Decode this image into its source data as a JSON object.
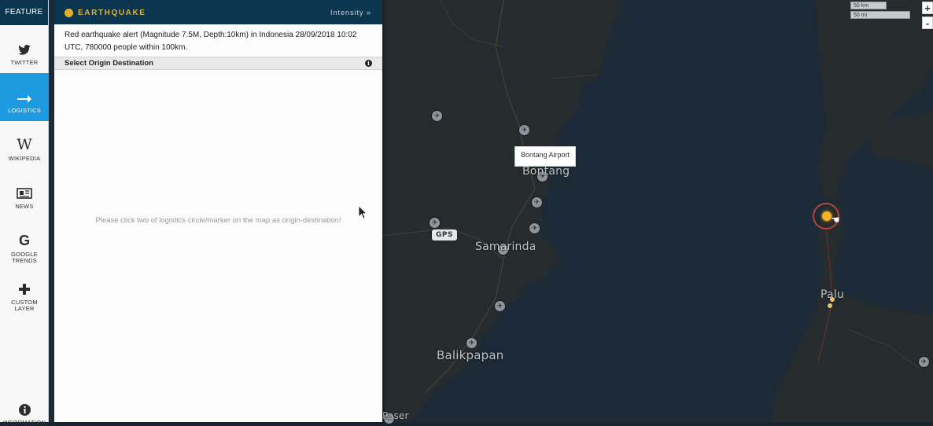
{
  "sidebar": {
    "header": "FEATURE",
    "items": [
      {
        "label": "TWITTER",
        "icon": "twitter-icon",
        "active": false
      },
      {
        "label": "LOGISTICS",
        "icon": "arrow-right-icon",
        "active": true
      },
      {
        "label": "WIKIPEDIA",
        "icon": "wikipedia-icon",
        "active": false
      },
      {
        "label": "NEWS",
        "icon": "newspaper-icon",
        "active": false
      },
      {
        "label_line1": "GOOGLE",
        "label_line2": "TRENDS",
        "icon": "google-icon",
        "active": false
      },
      {
        "label_line1": "CUSTOM",
        "label_line2": "LAYER",
        "icon": "plus-icon",
        "active": false
      },
      {
        "label": "INFORMATION",
        "icon": "info-icon",
        "active": false
      }
    ]
  },
  "panel": {
    "title": "EARTHQUAKE",
    "intensity_label": "Intensity »",
    "description": "Red earthquake alert (Magnitude 7.5M, Depth:10km) in Indonesia 28/09/2018 10:02 UTC, 780000 people within 100km.",
    "section_title": "Select Origin Destination",
    "hint": "Please click two of logistics circle/marker on the map as origin-destination!"
  },
  "map": {
    "tooltip": "Bontang Airport",
    "badge": "GPS",
    "labels": {
      "bontang": "Bontang",
      "samarinda": "Samarinda",
      "balikpapan": "Balikpapan",
      "palu": "Palu",
      "paser": "Paser"
    },
    "scale_km": "50 km",
    "scale_mi": "50 mi",
    "zoom_in": "+",
    "zoom_out": "-",
    "colors": {
      "sea": "#1c2a37",
      "land": "#262b2e",
      "quake": "#f5b324",
      "ring": "#b2473a"
    }
  }
}
